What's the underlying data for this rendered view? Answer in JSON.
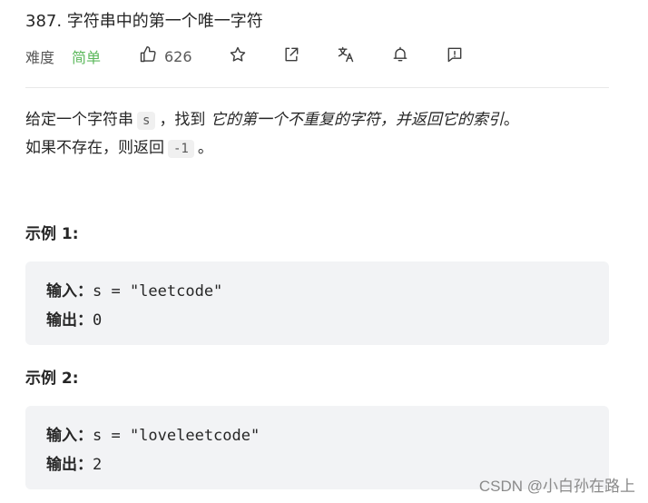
{
  "problem": {
    "title": "387. 字符串中的第一个唯一字符",
    "difficulty_label": "难度",
    "difficulty": "简单",
    "likes": "626",
    "icons": [
      "thumbs-up-icon",
      "star-icon",
      "share-icon",
      "translate-icon",
      "bell-icon",
      "feedback-icon"
    ]
  },
  "description": {
    "line1_pre": "给定一个字符串",
    "var_s": "s",
    "line1_mid": "，找到",
    "line1_em": "它的第一个不重复的字符，并返回它的索引",
    "line1_end": "。",
    "line2_pre": "如果不存在，则返回",
    "neg_one": "-1",
    "line2_end": "。"
  },
  "examples": [
    {
      "title": "示例 1:",
      "input_label": "输入：",
      "input": "s = \"leetcode\"",
      "output_label": "输出：",
      "output": "0"
    },
    {
      "title": "示例 2:",
      "input_label": "输入：",
      "input": "s = \"loveleetcode\"",
      "output_label": "输出：",
      "output": "2"
    }
  ],
  "watermark": "CSDN @小白孙在路上",
  "colors": {
    "easy": "#5cb85c",
    "code_bg": "#f2f3f5",
    "text": "#262626"
  }
}
